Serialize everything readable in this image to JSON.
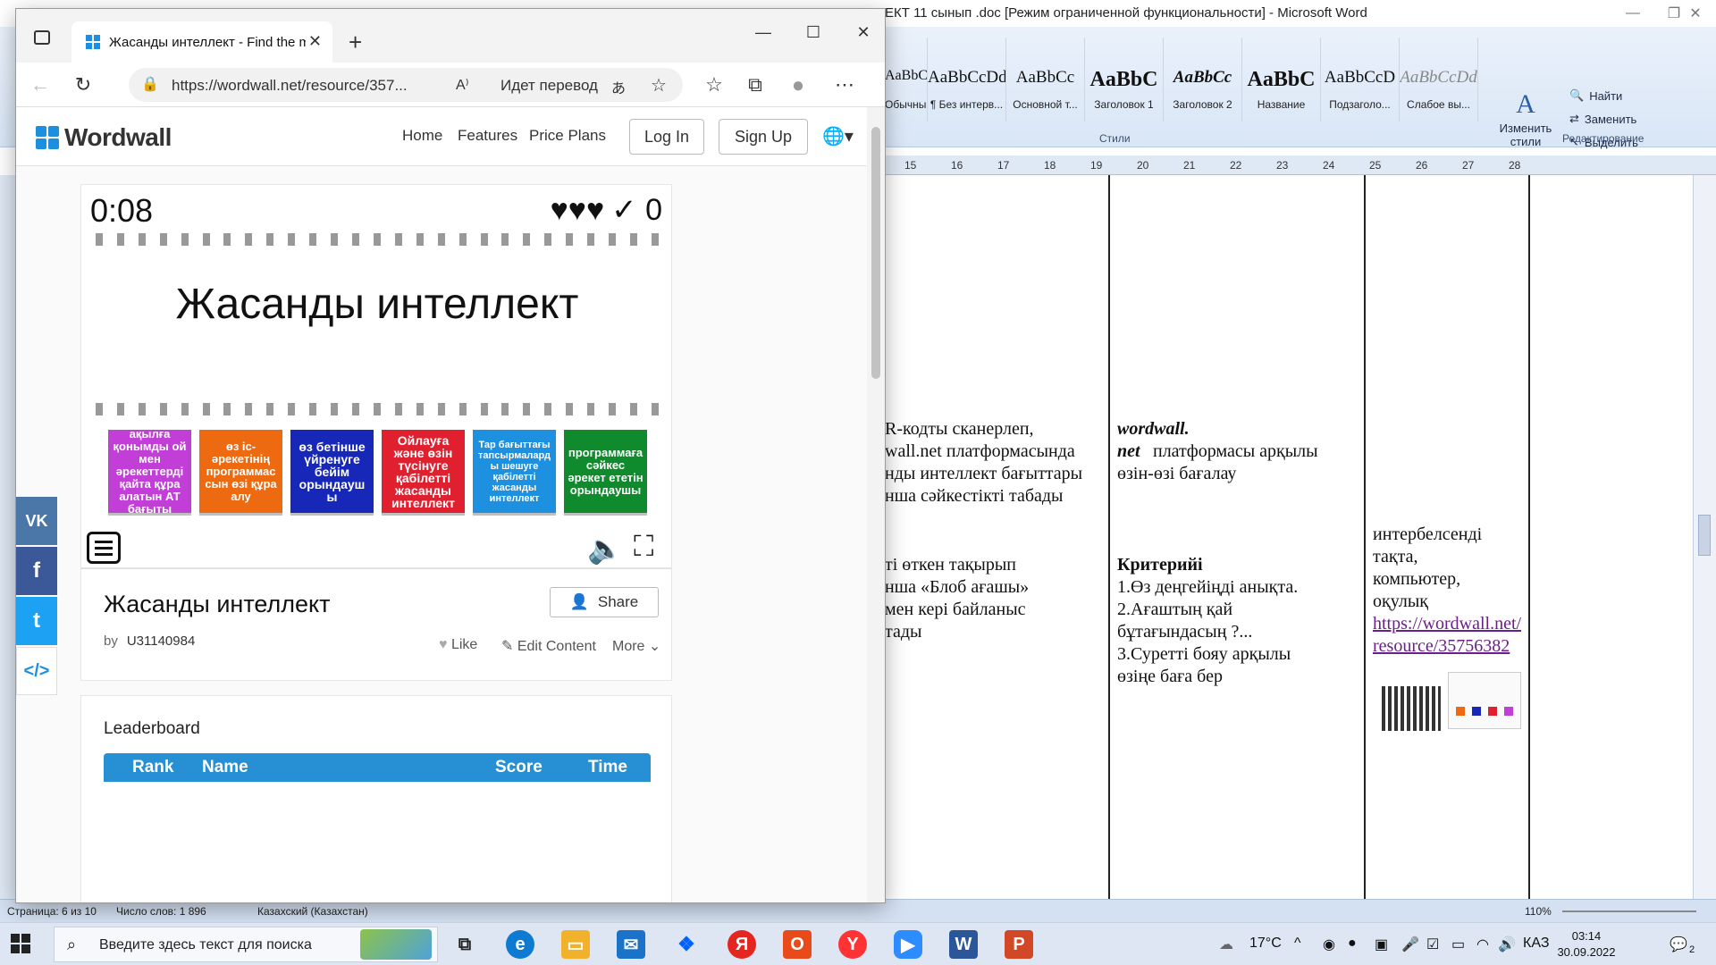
{
  "word": {
    "title": "ЕКТ 11 сынып .doc [Режим ограниченной функциональности] - Microsoft Word",
    "styles": [
      {
        "sample": "AaBbCcDd",
        "name": "Обычный"
      },
      {
        "sample": "AaBbCcDd",
        "name": "¶ Без интерв..."
      },
      {
        "sample": "AaBbCc",
        "name": "Основной т..."
      },
      {
        "sample": "AaBbC",
        "name": "Заголовок 1"
      },
      {
        "sample": "AaBbCc",
        "name": "Заголовок 2"
      },
      {
        "sample": "AaBbC",
        "name": "Название"
      },
      {
        "sample": "AaBbCcD",
        "name": "Подзаголо..."
      },
      {
        "sample": "AaBbCcDd",
        "name": "Слабое вы..."
      }
    ],
    "styles_group": "Стили",
    "change_styles": "Изменить стили",
    "editing": {
      "find": "Найти",
      "replace": "Заменить",
      "select": "Выделить",
      "group": "Редактирование"
    },
    "ruler_marks": [
      "15",
      "16",
      "17",
      "18",
      "19",
      "20",
      "21",
      "22",
      "23",
      "24",
      "25",
      "26",
      "27",
      "28"
    ],
    "col1_text_a": "R-кодты сканерлеп,\nwall.net платформасында\nнды интеллект бағыттары\nнша сәйкестікті табады",
    "col1_text_b": "ті өткен тақырып\nнша «Блоб ағашы»\nмен кері байланыс\nтады",
    "col2_text_a_bold": "wordwall.\nnet",
    "col2_text_a": "платформасы арқылы\nөзін-өзі бағалау",
    "col2_criteria_title": "Критерийі",
    "col2_criteria": "1.Өз деңгейіңді анықта.\n2.Ағаштың қай\nбұтағындасың ?...\n3.Суретті бояу арқылы\nөзіңе баға бер",
    "col3_text": "интербелсенді\nтақта,\nкомпьютер,\nоқулық",
    "col3_link": "https://wordwall.net/resource/35756382",
    "status": {
      "page": "Страница: 6 из 10",
      "words": "Число слов: 1 896",
      "lang": "Казахский (Казахстан)",
      "zoom": "110%"
    }
  },
  "browser": {
    "tab_title": "Жасанды интеллект - Find the match",
    "url": "https://wordwall.net/resource/357...",
    "translate": "Идет перевод",
    "site": {
      "logo": "Wordwall",
      "nav": [
        "Home",
        "Features",
        "Price Plans"
      ],
      "login": "Log In",
      "signup": "Sign Up"
    },
    "activity": {
      "timer": "0:08",
      "hearts": "♥♥♥",
      "score": "✓ 0",
      "question": "Жасанды интеллект",
      "answers": [
        {
          "text": "ақылға қонымды ой мен әрекеттерді қайта құра алатын АТ бағыты",
          "color": "#c13fd6"
        },
        {
          "text": "өз іс-әрекетінің программассын өзі құра алу",
          "color": "#ee6a10"
        },
        {
          "text": "өз бетінше үйренуге бейім орындаушы",
          "color": "#1727b8"
        },
        {
          "text": "Ойлауға және өзін түсінуге қабілетті жасанды интеллект",
          "color": "#e1202f"
        },
        {
          "text": "Тар бағыттағы тапсырмаларды шешуге қабілетті жасанды интеллект",
          "color": "#1e90e0"
        },
        {
          "text": "программаға сәйкес әрекет ететін орындаушы",
          "color": "#0f8a2c"
        }
      ]
    },
    "info": {
      "title": "Жасанды интеллект",
      "by": "by",
      "author": "U31140984",
      "share": "Share",
      "like": "Like",
      "edit": "Edit Content",
      "more": "More"
    },
    "leaderboard": {
      "title": "Leaderboard",
      "columns": [
        "Rank",
        "Name",
        "Score",
        "Time"
      ]
    },
    "social": [
      {
        "label": "VK",
        "color": "#4a76a8"
      },
      {
        "label": "f",
        "color": "#3b5998"
      },
      {
        "label": "t",
        "color": "#1da1f2"
      },
      {
        "label": "</>",
        "color": "#ffffff"
      }
    ]
  },
  "taskbar": {
    "search_placeholder": "Введите здесь текст для поиска",
    "weather": "17°C",
    "lang": "КАЗ",
    "time": "03:14",
    "date": "30.09.2022",
    "notifications": "2"
  }
}
